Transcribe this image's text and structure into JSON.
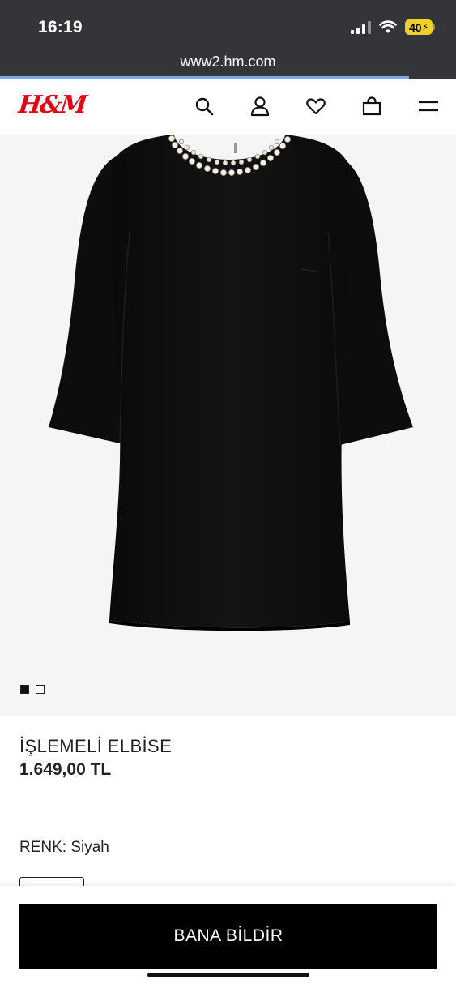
{
  "status_bar": {
    "time": "16:19",
    "battery_level": "40"
  },
  "browser": {
    "url": "www2.hm.com"
  },
  "header": {
    "logo": "H&M",
    "icons": [
      "search-icon",
      "account-icon",
      "favorites-heart-icon",
      "shopping-bag-icon",
      "menu-hamburger-icon"
    ]
  },
  "gallery": {
    "image_count": 2,
    "active_index": 0
  },
  "product": {
    "name": "İŞLEMELİ ELBİSE",
    "price": "1.649,00 TL",
    "color_label": "RENK: Siyah"
  },
  "cta": {
    "label": "BANA BİLDİR"
  },
  "colors": {
    "brand_red": "#e50010",
    "chrome_bg": "#333538",
    "battery_yellow": "#f3cf2a",
    "button_black": "#000000"
  }
}
